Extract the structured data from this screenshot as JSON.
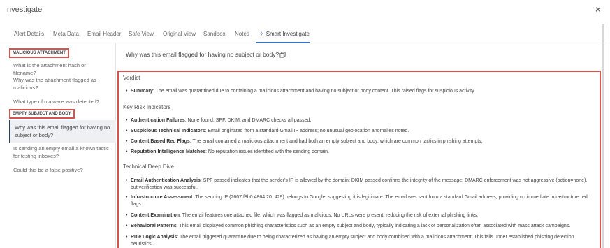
{
  "window": {
    "title": "Investigate",
    "close_label": "×"
  },
  "tabs": [
    {
      "label": "Alert Details"
    },
    {
      "label": "Meta Data"
    },
    {
      "label": "Email Header"
    },
    {
      "label": "Safe View"
    },
    {
      "label": "Original View"
    },
    {
      "label": "Sandbox"
    },
    {
      "label": "Notes"
    },
    {
      "label": "Smart Investigate",
      "icon": "sparkle-icon",
      "active": true
    }
  ],
  "sidebar": {
    "categories": [
      {
        "label": "MALICIOUS ATTACHMENT",
        "questions": [
          "What is the attachment hash or filename?",
          "Why was the attachment flagged as malicious?",
          "What type of malware was detected?"
        ]
      },
      {
        "label": "EMPTY SUBJECT AND BODY",
        "questions": [
          "Why was this email flagged for having no subject or body?",
          "Is sending an empty email a known tactic for testing inboxes?",
          "Could this be a false positive?"
        ]
      }
    ]
  },
  "main": {
    "question": "Why was this email flagged for having no subject or body?",
    "sections": [
      {
        "title": "Verdict",
        "items": [
          {
            "label": "Summary",
            "text": ": The email was quarantined due to containing a malicious attachment and having no subject or body content. This raised flags for suspicious activity."
          }
        ]
      },
      {
        "title": "Key Risk Indicators",
        "items": [
          {
            "label": "Authentication Failures",
            "text": ": None found; SPF, DKIM, and DMARC checks all passed."
          },
          {
            "label": "Suspicious Technical Indicators",
            "text": ": Email originated from a standard Gmail IP address; no unusual geolocation anomalies noted."
          },
          {
            "label": "Content Based Red Flags",
            "text": ": The email contained a malicious attachment and had both an empty subject and body, which are common tactics in phishing attempts."
          },
          {
            "label": "Reputation Intelligence Matches",
            "text": ": No reputation issues identified with the sending domain."
          }
        ]
      },
      {
        "title": "Technical Deep Dive",
        "items": [
          {
            "label": "Email Authentication Analysis",
            "text": ": SPF passed indicates that the sender's IP is allowed by the domain; DKIM passed confirms the integrity of the message; DMARC enforcement was not aggressive (action=none), but verification was successful."
          },
          {
            "label": "Infrastructure Assessment",
            "text": ": The sending IP (2607:f8b0:4864:20::429) belongs to Google, suggesting it is legitimate. The email was sent from a standard Gmail address, providing no immediate infrastructure red flags."
          },
          {
            "label": "Content Examination",
            "text": ": The email features one attached file, which was flagged as malicious. No URLs were present, reducing the risk of external phishing links."
          },
          {
            "label": "Behavioral Patterns",
            "text": ": This email displayed common phishing characteristics such as an empty subject and body, typically indicating a lack of personalization often associated with mass attack campaigns."
          },
          {
            "label": "Rule Logic Analysis",
            "text": ": The email triggered quarantine due to being characterized as having an empty subject and body combined with a malicious attachment. This falls under established phishing detection heuristics."
          }
        ]
      }
    ]
  },
  "colors": {
    "accent": "#3a6fc4",
    "highlight_border": "#d9534f",
    "selected_bg": "#eef0f3"
  }
}
